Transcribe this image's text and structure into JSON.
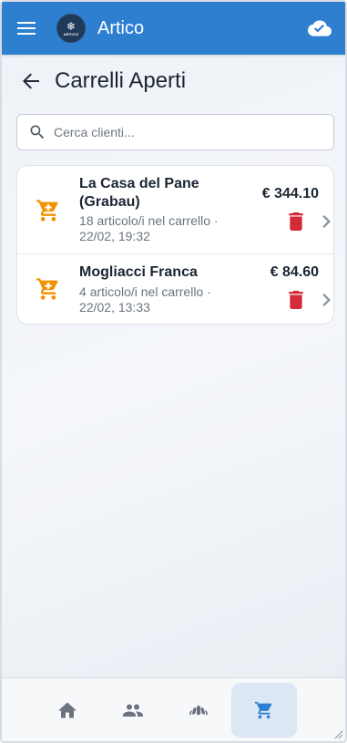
{
  "app": {
    "title": "Artico",
    "logo_text": "ARTICO"
  },
  "page": {
    "title": "Carrelli Aperti"
  },
  "search": {
    "placeholder": "Cerca clienti..."
  },
  "carts": [
    {
      "name": "La Casa del Pane (Grabau)",
      "meta": "18 articolo/i nel carrello · 22/02, 19:32",
      "total": "€ 344.10"
    },
    {
      "name": "Mogliacci Franca",
      "meta": "4 articolo/i nel carrello · 22/02, 13:33",
      "total": "€ 84.60"
    }
  ],
  "bottom_nav": {
    "items": [
      {
        "icon": "home-icon"
      },
      {
        "icon": "people-icon"
      },
      {
        "icon": "bakery-icon"
      },
      {
        "icon": "cart-icon",
        "active": true
      }
    ]
  },
  "colors": {
    "appbar": "#2f7fd1",
    "cart_icon": "#f39200",
    "delete_icon": "#d42b3a",
    "active_nav": "#2f7fd1",
    "inactive_nav": "#6b7280"
  }
}
